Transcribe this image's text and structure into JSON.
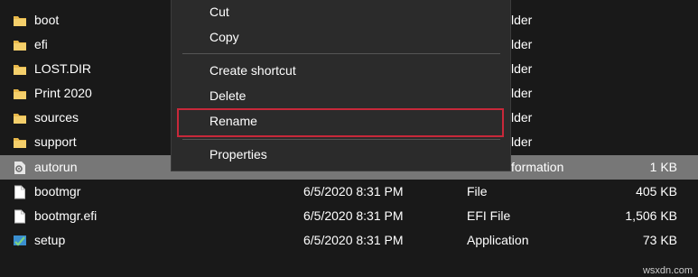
{
  "files": [
    {
      "name": "boot",
      "date": "",
      "type": "lder",
      "size": "",
      "icon": "folder-icon"
    },
    {
      "name": "efi",
      "date": "",
      "type": "lder",
      "size": "",
      "icon": "folder-icon"
    },
    {
      "name": "LOST.DIR",
      "date": "",
      "type": "lder",
      "size": "",
      "icon": "folder-icon"
    },
    {
      "name": "Print 2020",
      "date": "",
      "type": "lder",
      "size": "",
      "icon": "folder-icon"
    },
    {
      "name": "sources",
      "date": "",
      "type": "lder",
      "size": "",
      "icon": "folder-icon"
    },
    {
      "name": "support",
      "date": "",
      "type": "lder",
      "size": "",
      "icon": "folder-icon"
    },
    {
      "name": "autorun",
      "date": "",
      "type": "formation",
      "size": "1 KB",
      "icon": "settings-file-icon",
      "selected": true
    },
    {
      "name": "bootmgr",
      "date": "6/5/2020 8:31 PM",
      "type": "File",
      "size": "405 KB",
      "icon": "file-icon"
    },
    {
      "name": "bootmgr.efi",
      "date": "6/5/2020 8:31 PM",
      "type": "EFI File",
      "size": "1,506 KB",
      "icon": "file-icon"
    },
    {
      "name": "setup",
      "date": "6/5/2020 8:31 PM",
      "type": "Application",
      "size": "73 KB",
      "icon": "setup-app-icon"
    }
  ],
  "context_menu": {
    "cut": "Cut",
    "copy": "Copy",
    "create_shortcut": "Create shortcut",
    "delete": "Delete",
    "rename": "Rename",
    "properties": "Properties",
    "highlight_color": "#c8283a"
  },
  "watermark": "wsxdn.com",
  "colors": {
    "background": "#191919",
    "selected_row": "#777777",
    "menu_bg": "#2b2b2b",
    "folder": "#e8b84a"
  }
}
